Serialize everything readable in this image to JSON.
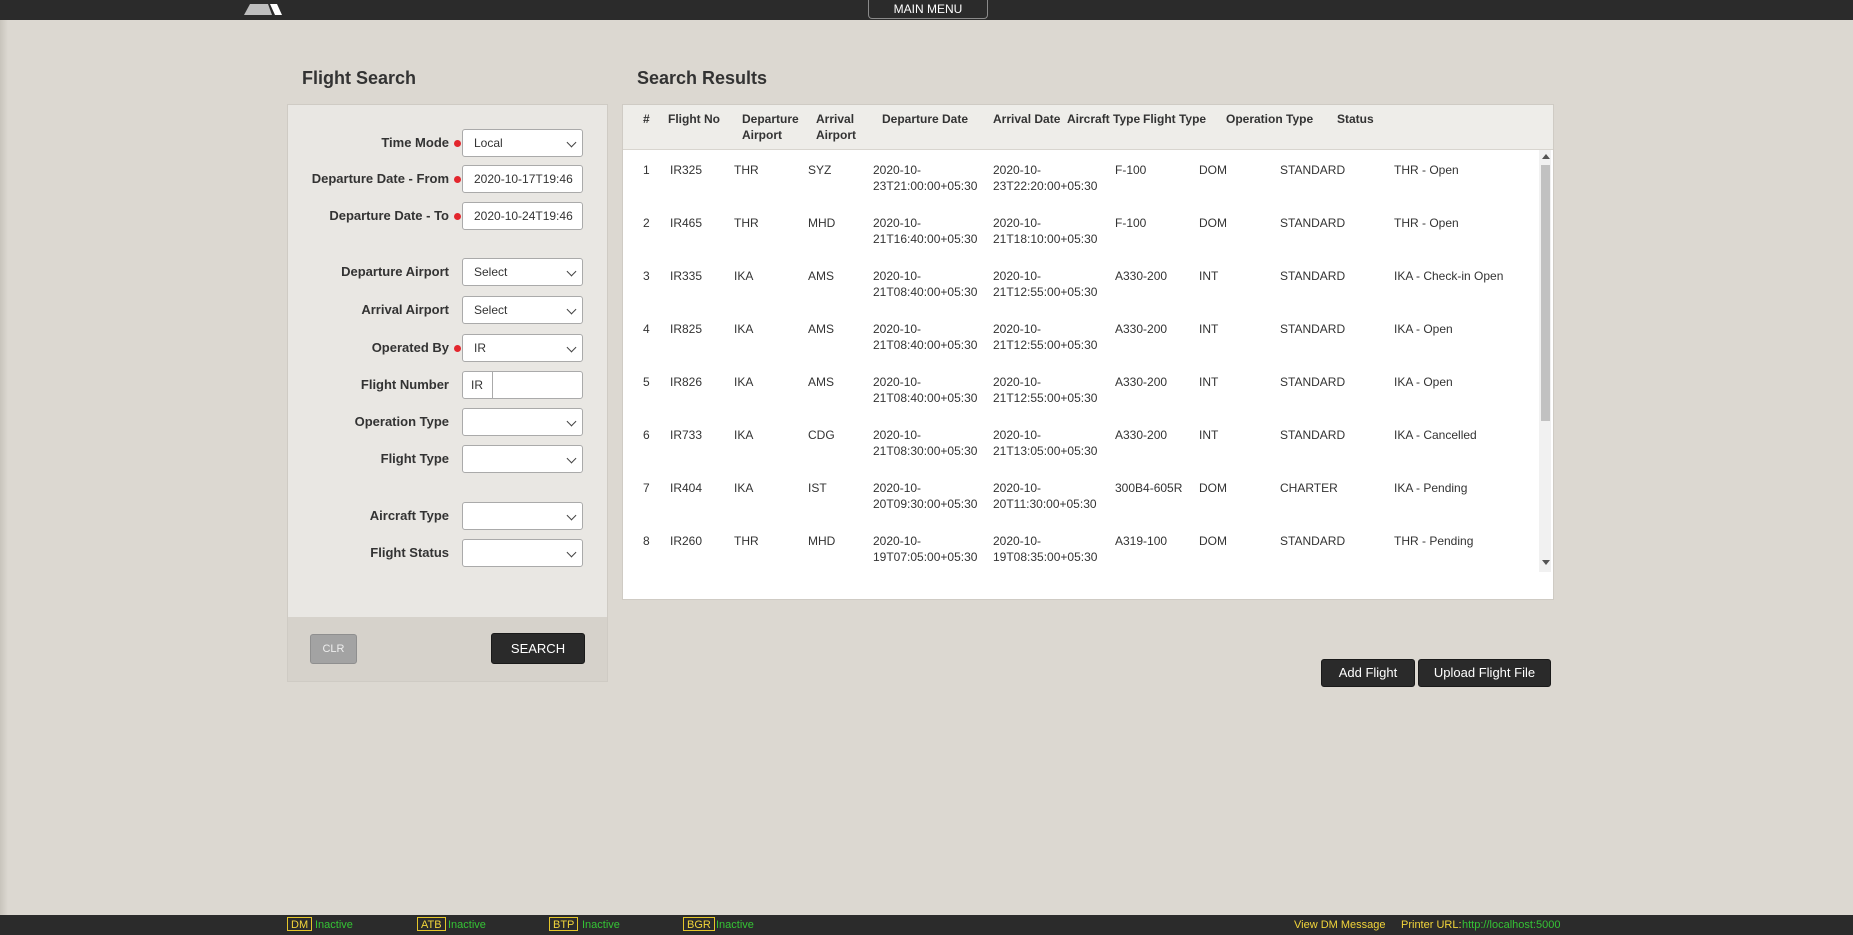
{
  "topbar": {
    "main_menu": "MAIN MENU"
  },
  "search": {
    "title": "Flight Search",
    "fields": {
      "time_mode": {
        "label": "Time Mode",
        "value": "Local"
      },
      "dep_from": {
        "label": "Departure Date - From",
        "value": "2020-10-17T19:46"
      },
      "dep_to": {
        "label": "Departure Date - To",
        "value": "2020-10-24T19:46"
      },
      "dep_airport": {
        "label": "Departure Airport",
        "value": "Select"
      },
      "arr_airport": {
        "label": "Arrival Airport",
        "value": "Select"
      },
      "operated_by": {
        "label": "Operated By",
        "value": "IR"
      },
      "flight_number": {
        "label": "Flight Number",
        "prefix": "IR",
        "value": ""
      },
      "operation_type": {
        "label": "Operation Type",
        "value": ""
      },
      "flight_type": {
        "label": "Flight Type",
        "value": ""
      },
      "aircraft_type": {
        "label": "Aircraft Type",
        "value": ""
      },
      "flight_status": {
        "label": "Flight Status",
        "value": ""
      }
    },
    "clr_label": "CLR",
    "search_label": "SEARCH"
  },
  "results": {
    "title": "Search Results",
    "headers": {
      "num": "#",
      "flight_no": "Flight No",
      "dep_airport_1": "Departure",
      "dep_airport_2": "Airport",
      "arr_airport_1": "Arrival",
      "arr_airport_2": "Airport",
      "dep_date": "Departure Date",
      "arr_date": "Arrival Date",
      "aircraft_type": "Aircraft Type",
      "flight_type": "Flight Type",
      "operation_type": "Operation Type",
      "status": "Status"
    },
    "rows": [
      {
        "num": "1",
        "flight_no": "IR325",
        "dep": "THR",
        "arr": "SYZ",
        "dep_date_1": "2020-10-",
        "dep_date_2": "23T21:00:00+05:30",
        "arr_date_1": "2020-10-",
        "arr_date_2": "23T22:20:00+05:30",
        "aircraft": "F-100",
        "ftype": "DOM",
        "optype": "STANDARD",
        "status": "THR - Open"
      },
      {
        "num": "2",
        "flight_no": "IR465",
        "dep": "THR",
        "arr": "MHD",
        "dep_date_1": "2020-10-",
        "dep_date_2": "21T16:40:00+05:30",
        "arr_date_1": "2020-10-",
        "arr_date_2": "21T18:10:00+05:30",
        "aircraft": "F-100",
        "ftype": "DOM",
        "optype": "STANDARD",
        "status": "THR - Open"
      },
      {
        "num": "3",
        "flight_no": "IR335",
        "dep": "IKA",
        "arr": "AMS",
        "dep_date_1": "2020-10-",
        "dep_date_2": "21T08:40:00+05:30",
        "arr_date_1": "2020-10-",
        "arr_date_2": "21T12:55:00+05:30",
        "aircraft": "A330-200",
        "ftype": "INT",
        "optype": "STANDARD",
        "status": "IKA - Check-in Open"
      },
      {
        "num": "4",
        "flight_no": "IR825",
        "dep": "IKA",
        "arr": "AMS",
        "dep_date_1": "2020-10-",
        "dep_date_2": "21T08:40:00+05:30",
        "arr_date_1": "2020-10-",
        "arr_date_2": "21T12:55:00+05:30",
        "aircraft": "A330-200",
        "ftype": "INT",
        "optype": "STANDARD",
        "status": "IKA - Open"
      },
      {
        "num": "5",
        "flight_no": "IR826",
        "dep": "IKA",
        "arr": "AMS",
        "dep_date_1": "2020-10-",
        "dep_date_2": "21T08:40:00+05:30",
        "arr_date_1": "2020-10-",
        "arr_date_2": "21T12:55:00+05:30",
        "aircraft": "A330-200",
        "ftype": "INT",
        "optype": "STANDARD",
        "status": "IKA - Open"
      },
      {
        "num": "6",
        "flight_no": "IR733",
        "dep": "IKA",
        "arr": "CDG",
        "dep_date_1": "2020-10-",
        "dep_date_2": "21T08:30:00+05:30",
        "arr_date_1": "2020-10-",
        "arr_date_2": "21T13:05:00+05:30",
        "aircraft": "A330-200",
        "ftype": "INT",
        "optype": "STANDARD",
        "status": "IKA - Cancelled"
      },
      {
        "num": "7",
        "flight_no": "IR404",
        "dep": "IKA",
        "arr": "IST",
        "dep_date_1": "2020-10-",
        "dep_date_2": "20T09:30:00+05:30",
        "arr_date_1": "2020-10-",
        "arr_date_2": "20T11:30:00+05:30",
        "aircraft": "300B4-605R",
        "ftype": "DOM",
        "optype": "CHARTER",
        "status": "IKA - Pending"
      },
      {
        "num": "8",
        "flight_no": "IR260",
        "dep": "THR",
        "arr": "MHD",
        "dep_date_1": "2020-10-",
        "dep_date_2": "19T07:05:00+05:30",
        "arr_date_1": "2020-10-",
        "arr_date_2": "19T08:35:00+05:30",
        "aircraft": "A319-100",
        "ftype": "DOM",
        "optype": "STANDARD",
        "status": "THR - Pending"
      }
    ],
    "add_flight": "Add Flight",
    "upload_flight_file": "Upload Flight File"
  },
  "statusbar": {
    "items": [
      {
        "tag": "DM",
        "value": "Inactive"
      },
      {
        "tag": "ATB",
        "value": "Inactive"
      },
      {
        "tag": "BTP",
        "value": "Inactive"
      },
      {
        "tag": "BGR",
        "value": "Inactive"
      }
    ],
    "view_dm_message": "View DM Message",
    "printer_label": "Printer URL:",
    "printer_url": "http://localhost:5000"
  },
  "colors": {
    "accent_dark": "#2a2a2a",
    "required": "#e3262d",
    "status_yellow": "#f2d53a",
    "status_green": "#35c435"
  }
}
